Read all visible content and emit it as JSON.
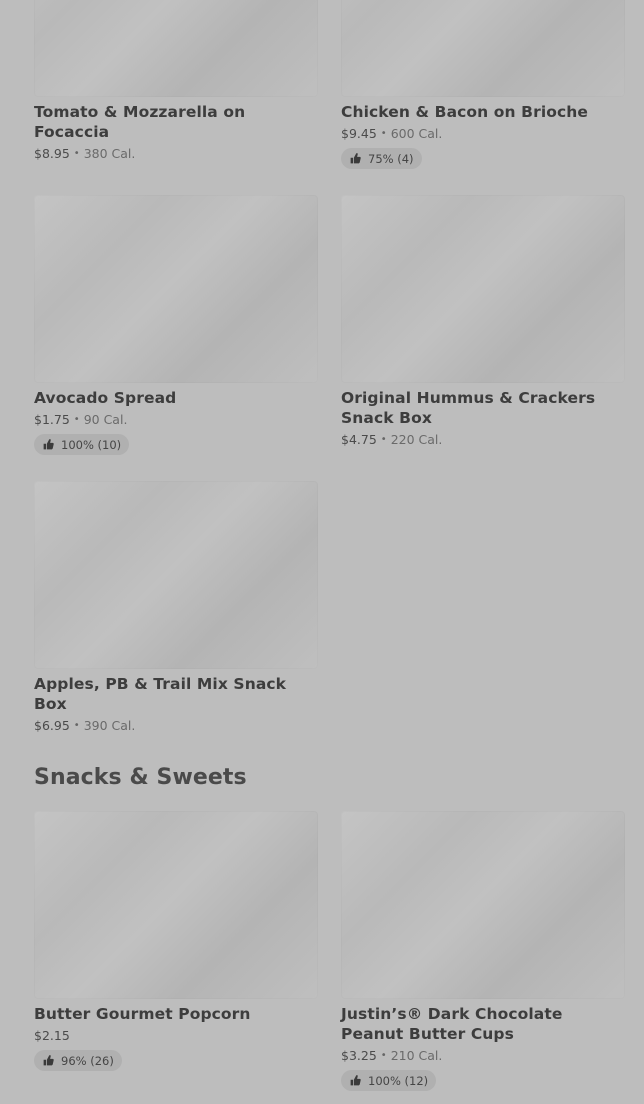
{
  "colors": {
    "background": "#bdbdbd",
    "placeholder": "#bfbfbf",
    "badge": "#b0b0b0",
    "text": "#3d3d3d"
  },
  "menu": {
    "items": [
      {
        "name": "Tomato & Mozzarella on Focaccia",
        "price": "$8.95",
        "separator": "•",
        "calories": "380 Cal.",
        "rating": null
      },
      {
        "name": "Chicken & Bacon on Brioche",
        "price": "$9.45",
        "separator": "•",
        "calories": "600 Cal.",
        "rating": "75% (4)"
      },
      {
        "name": "Avocado Spread",
        "price": "$1.75",
        "separator": "•",
        "calories": "90 Cal.",
        "rating": "100% (10)"
      },
      {
        "name": "Original Hummus & Crackers Snack Box",
        "price": "$4.75",
        "separator": "•",
        "calories": "220 Cal.",
        "rating": null
      },
      {
        "name": "Apples, PB & Trail Mix Snack Box",
        "price": "$6.95",
        "separator": "•",
        "calories": "390 Cal.",
        "rating": null
      }
    ]
  },
  "snacks": {
    "title": "Snacks & Sweets",
    "items": [
      {
        "name": "Butter Gourmet Popcorn",
        "price": "$2.15",
        "rating": "96% (26)"
      },
      {
        "name": "Justin’s® Dark Chocolate Peanut Butter Cups",
        "price": "$3.25",
        "separator": "•",
        "calories": "210 Cal.",
        "rating": "100% (12)"
      }
    ]
  },
  "icons": {
    "thumbs_up": "thumbs-up-icon"
  }
}
